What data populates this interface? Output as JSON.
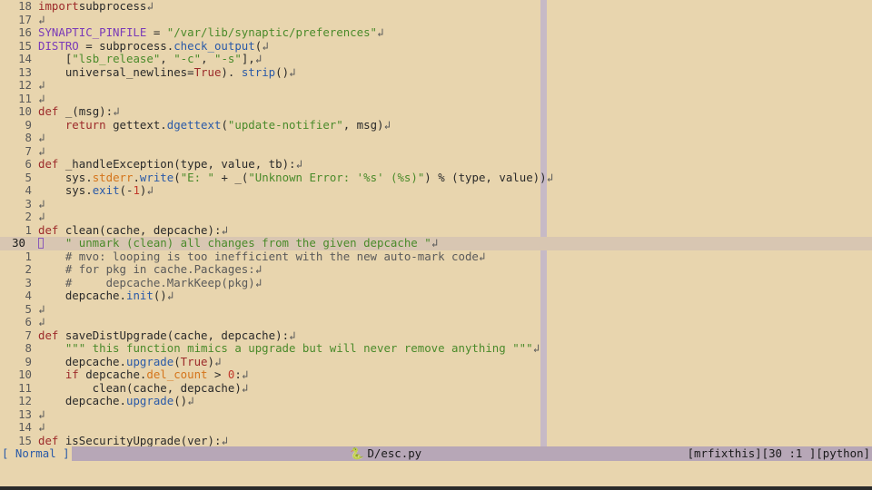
{
  "lines": [
    {
      "n": "18",
      "tokens": [
        [
          "kw",
          "import"
        ],
        [
          "",
          "subprocess"
        ]
      ]
    },
    {
      "n": "17",
      "tokens": []
    },
    {
      "n": "16",
      "tokens": [
        [
          "const",
          "SYNAPTIC_PINFILE"
        ],
        [
          "",
          " = "
        ],
        [
          "str",
          "\"/var/lib/synaptic/preferences\""
        ]
      ]
    },
    {
      "n": "15",
      "tokens": [
        [
          "const",
          "DISTRO"
        ],
        [
          "",
          " = subprocess."
        ],
        [
          "attr",
          "check_output"
        ],
        [
          "",
          "("
        ]
      ]
    },
    {
      "n": "14",
      "tokens": [
        [
          "",
          "    ["
        ],
        [
          "str",
          "\"lsb_release\""
        ],
        [
          "",
          ", "
        ],
        [
          "str",
          "\"-c\""
        ],
        [
          "",
          ", "
        ],
        [
          "str",
          "\"-s\""
        ],
        [
          "",
          "],"
        ]
      ]
    },
    {
      "n": "13",
      "tokens": [
        [
          "",
          "    universal_newlines="
        ],
        [
          "bool",
          "True"
        ],
        [
          "",
          "). "
        ],
        [
          "attr",
          "strip"
        ],
        [
          "",
          "()"
        ]
      ]
    },
    {
      "n": "12",
      "tokens": []
    },
    {
      "n": "11",
      "tokens": []
    },
    {
      "n": "10",
      "tokens": [
        [
          "kw",
          "def"
        ],
        [
          "",
          " _(msg):"
        ]
      ]
    },
    {
      "n": "9",
      "tokens": [
        [
          "",
          "    "
        ],
        [
          "kw",
          "return"
        ],
        [
          "",
          " gettext."
        ],
        [
          "attr",
          "dgettext"
        ],
        [
          "",
          "("
        ],
        [
          "str",
          "\"update-notifier\""
        ],
        [
          "",
          ", msg)"
        ]
      ]
    },
    {
      "n": "8",
      "tokens": []
    },
    {
      "n": "7",
      "tokens": []
    },
    {
      "n": "6",
      "tokens": [
        [
          "kw",
          "def"
        ],
        [
          "",
          " _handleException(type, value, tb):"
        ]
      ]
    },
    {
      "n": "5",
      "tokens": [
        [
          "",
          "    sys."
        ],
        [
          "self-attr",
          "stderr"
        ],
        [
          "",
          "."
        ],
        [
          "attr",
          "write"
        ],
        [
          "",
          "("
        ],
        [
          "str",
          "\"E: \""
        ],
        [
          "",
          " + _("
        ],
        [
          "str",
          "\"Unknown Error: '%s' (%s)\""
        ],
        [
          "",
          ") % (type, value))"
        ]
      ]
    },
    {
      "n": "4",
      "tokens": [
        [
          "",
          "    sys."
        ],
        [
          "attr",
          "exit"
        ],
        [
          "",
          "(-"
        ],
        [
          "num",
          "1"
        ],
        [
          "",
          ")"
        ]
      ]
    },
    {
      "n": "3",
      "tokens": []
    },
    {
      "n": "2",
      "tokens": []
    },
    {
      "n": "1",
      "tokens": [
        [
          "kw",
          "def"
        ],
        [
          "",
          " clean(cache, depcache):"
        ]
      ]
    },
    {
      "n": "30",
      "current": true,
      "tokens": [
        [
          "",
          "    "
        ],
        [
          "str",
          "\" unmark (clean) all changes from the given depcache \""
        ]
      ]
    },
    {
      "n": "1",
      "tokens": [
        [
          "",
          "    "
        ],
        [
          "cmt",
          "# mvo: looping is too inefficient with the new auto-mark code"
        ]
      ]
    },
    {
      "n": "2",
      "tokens": [
        [
          "",
          "    "
        ],
        [
          "cmt",
          "# for pkg in cache.Packages:"
        ]
      ]
    },
    {
      "n": "3",
      "tokens": [
        [
          "",
          "    "
        ],
        [
          "cmt",
          "#     depcache.MarkKeep(pkg)"
        ]
      ]
    },
    {
      "n": "4",
      "tokens": [
        [
          "",
          "    depcache."
        ],
        [
          "attr",
          "init"
        ],
        [
          "",
          "()"
        ]
      ]
    },
    {
      "n": "5",
      "tokens": []
    },
    {
      "n": "6",
      "tokens": []
    },
    {
      "n": "7",
      "tokens": [
        [
          "kw",
          "def"
        ],
        [
          "",
          " saveDistUpgrade(cache, depcache):"
        ]
      ]
    },
    {
      "n": "8",
      "tokens": [
        [
          "",
          "    "
        ],
        [
          "str",
          "\"\"\" this function mimics a upgrade but will never remove anything \"\"\""
        ]
      ]
    },
    {
      "n": "9",
      "tokens": [
        [
          "",
          "    depcache."
        ],
        [
          "attr",
          "upgrade"
        ],
        [
          "",
          "("
        ],
        [
          "bool",
          "True"
        ],
        [
          "",
          ")"
        ]
      ]
    },
    {
      "n": "10",
      "tokens": [
        [
          "",
          "    "
        ],
        [
          "kw",
          "if"
        ],
        [
          "",
          " depcache."
        ],
        [
          "self-attr",
          "del_count"
        ],
        [
          "",
          " > "
        ],
        [
          "num",
          "0"
        ],
        [
          "",
          ":"
        ]
      ]
    },
    {
      "n": "11",
      "tokens": [
        [
          "",
          "        clean(cache, depcache)"
        ]
      ]
    },
    {
      "n": "12",
      "tokens": [
        [
          "",
          "    depcache."
        ],
        [
          "attr",
          "upgrade"
        ],
        [
          "",
          "()"
        ]
      ]
    },
    {
      "n": "13",
      "tokens": []
    },
    {
      "n": "14",
      "tokens": []
    },
    {
      "n": "15",
      "tokens": [
        [
          "kw",
          "def"
        ],
        [
          "",
          " isSecurityUpgrade(ver):"
        ]
      ]
    }
  ],
  "newline_glyph": "↲",
  "statusline": {
    "mode": "[ Normal ]",
    "file_icon": "python-icon",
    "file_icon_glyph": "🐍",
    "filename": "D/esc.py",
    "branch": "[mrfixthis]",
    "position": "[30 :1 ]",
    "filetype": "[python]"
  }
}
